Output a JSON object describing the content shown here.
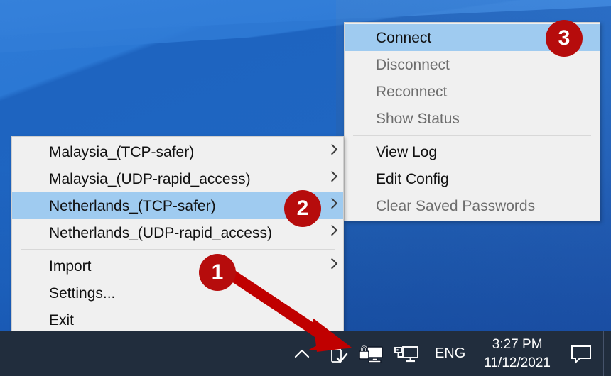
{
  "desktop": {
    "wallpaper_color": "#2173cf"
  },
  "root_menu": {
    "name": "openvpn-tray-menu",
    "items": [
      {
        "label": "Malaysia_(TCP-safer)",
        "state": "enabled",
        "submenu": true,
        "selected": false,
        "name": "menu-item-malaysia-tcp-safer"
      },
      {
        "label": "Malaysia_(UDP-rapid_access)",
        "state": "enabled",
        "submenu": true,
        "selected": false,
        "name": "menu-item-malaysia-udp-rapid-access"
      },
      {
        "label": "Netherlands_(TCP-safer)",
        "state": "enabled",
        "submenu": true,
        "selected": true,
        "name": "menu-item-netherlands-tcp-safer"
      },
      {
        "label": "Netherlands_(UDP-rapid_access)",
        "state": "enabled",
        "submenu": true,
        "selected": false,
        "name": "menu-item-netherlands-udp-rapid-access"
      },
      {
        "separator": true
      },
      {
        "label": "Import",
        "state": "enabled",
        "submenu": true,
        "selected": false,
        "name": "menu-item-import"
      },
      {
        "label": "Settings...",
        "state": "enabled",
        "submenu": false,
        "selected": false,
        "name": "menu-item-settings"
      },
      {
        "label": "Exit",
        "state": "enabled",
        "submenu": false,
        "selected": false,
        "name": "menu-item-exit"
      }
    ]
  },
  "sub_menu": {
    "name": "connection-submenu",
    "items": [
      {
        "label": "Connect",
        "state": "enabled",
        "selected": true,
        "name": "submenu-item-connect"
      },
      {
        "label": "Disconnect",
        "state": "disabled",
        "selected": false,
        "name": "submenu-item-disconnect"
      },
      {
        "label": "Reconnect",
        "state": "disabled",
        "selected": false,
        "name": "submenu-item-reconnect"
      },
      {
        "label": "Show Status",
        "state": "disabled",
        "selected": false,
        "name": "submenu-item-show-status"
      },
      {
        "separator": true
      },
      {
        "label": "View Log",
        "state": "enabled",
        "selected": false,
        "name": "submenu-item-view-log"
      },
      {
        "label": "Edit Config",
        "state": "enabled",
        "selected": false,
        "name": "submenu-item-edit-config"
      },
      {
        "label": "Clear Saved Passwords",
        "state": "disabled",
        "selected": false,
        "name": "submenu-item-clear-saved-passwords"
      }
    ]
  },
  "annotations": {
    "badge_color": "#b60c0c",
    "arrow_color": "#c00000",
    "steps": [
      {
        "number": "1",
        "name": "step-badge-1"
      },
      {
        "number": "2",
        "name": "step-badge-2"
      },
      {
        "number": "3",
        "name": "step-badge-3"
      }
    ]
  },
  "taskbar": {
    "background_color": "#212d3d",
    "tray": {
      "show_hidden_icons": "show-hidden-icons-chevron",
      "icons": [
        {
          "name": "safely-remove-hardware-icon"
        },
        {
          "name": "openvpn-gui-tray-icon"
        },
        {
          "name": "network-connection-icon"
        }
      ]
    },
    "language": "ENG",
    "clock": {
      "time": "3:27 PM",
      "date": "11/12/2021"
    },
    "action_center": "action-center-icon"
  }
}
